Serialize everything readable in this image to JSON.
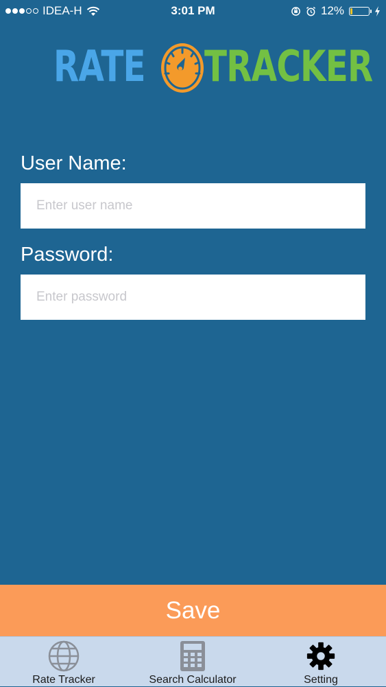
{
  "status_bar": {
    "carrier": "IDEA-H",
    "time": "3:01 PM",
    "battery": "12%",
    "battery_level": 0.12
  },
  "logo": {
    "left_word": "RATE",
    "right_word": "TRACKER",
    "colors": {
      "rate": "#4aa6e8",
      "tracker": "#73c043",
      "gauge": "#f39a2b"
    }
  },
  "form": {
    "username": {
      "label": "User Name:",
      "placeholder": "Enter user name",
      "value": ""
    },
    "password": {
      "label": "Password:",
      "placeholder": "Enter password",
      "value": ""
    }
  },
  "save_label": "Save",
  "tabs": [
    {
      "label": "Rate Tracker",
      "icon": "globe-icon"
    },
    {
      "label": "Search Calculator",
      "icon": "calculator-icon"
    },
    {
      "label": "Setting",
      "icon": "gear-icon"
    }
  ],
  "colors": {
    "background": "#1e6592",
    "save_button": "#fb9b58",
    "tab_bar": "#c9d9ec"
  }
}
